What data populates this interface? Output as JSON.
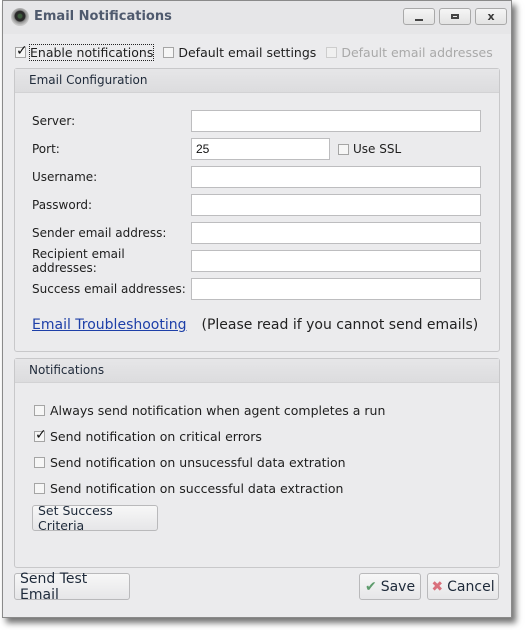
{
  "window": {
    "title": "Email Notifications",
    "icon": "app-icon",
    "controls": {
      "minimize": "minimize-icon",
      "maximize": "maximize-icon",
      "close_glyph": "x"
    }
  },
  "top_options": [
    {
      "label": "Enable notifications",
      "checked": true,
      "enabled": true
    },
    {
      "label": "Default email settings",
      "checked": false,
      "enabled": true
    },
    {
      "label": "Default email addresses",
      "checked": false,
      "enabled": false
    }
  ],
  "email_config": {
    "header": "Email Configuration",
    "fields": [
      {
        "label": "Server:",
        "value": ""
      },
      {
        "label": "Port:",
        "value": "25"
      },
      {
        "label": "Username:",
        "value": ""
      },
      {
        "label": "Password:",
        "value": ""
      },
      {
        "label": "Sender email address:",
        "value": ""
      },
      {
        "label": "Recipient email addresses:",
        "value": ""
      },
      {
        "label": "Success email addresses:",
        "value": ""
      }
    ],
    "use_ssl": {
      "label": "Use SSL",
      "checked": false
    },
    "troubleshooting_link": "Email Troubleshooting",
    "troubleshooting_note": "(Please read if you cannot send emails)"
  },
  "notifications": {
    "header": "Notifications",
    "options": [
      {
        "label": "Always send notification when agent completes a run",
        "checked": false
      },
      {
        "label": "Send notification on critical errors",
        "checked": true
      },
      {
        "label": "Send notification on unsucessful data extration",
        "checked": false
      },
      {
        "label": "Send notification on successful data extraction",
        "checked": false
      }
    ],
    "set_criteria_label": "Set Success Criteria"
  },
  "footer": {
    "send_test_label": "Send Test Email",
    "save_label": "Save",
    "save_icon": "✔",
    "cancel_label": "Cancel",
    "cancel_icon": "✖"
  }
}
